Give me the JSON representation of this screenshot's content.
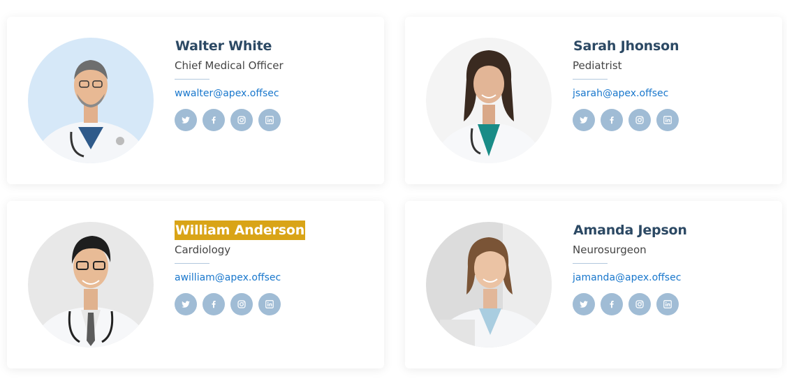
{
  "colors": {
    "name": "#2c4964",
    "email": "#1977cc",
    "social_bg": "#a0bcd5",
    "highlight": "#d9a417"
  },
  "doctors": [
    {
      "name": "Walter White",
      "role": "Chief Medical Officer",
      "email": "wwalter@apex.offsec",
      "social_icons": [
        "twitter-icon",
        "facebook-icon",
        "instagram-icon",
        "linkedin-icon"
      ]
    },
    {
      "name": "Sarah Jhonson",
      "role": "Pediatrist",
      "email": "jsarah@apex.offsec",
      "social_icons": [
        "twitter-icon",
        "facebook-icon",
        "instagram-icon",
        "linkedin-icon"
      ]
    },
    {
      "name": "William Anderson",
      "name_highlighted": true,
      "role": "Cardiology",
      "email": "awilliam@apex.offsec",
      "social_icons": [
        "twitter-icon",
        "facebook-icon",
        "instagram-icon",
        "linkedin-icon"
      ]
    },
    {
      "name": "Amanda Jepson",
      "role": "Neurosurgeon",
      "email": "jamanda@apex.offsec",
      "social_icons": [
        "twitter-icon",
        "facebook-icon",
        "instagram-icon",
        "linkedin-icon"
      ]
    }
  ]
}
